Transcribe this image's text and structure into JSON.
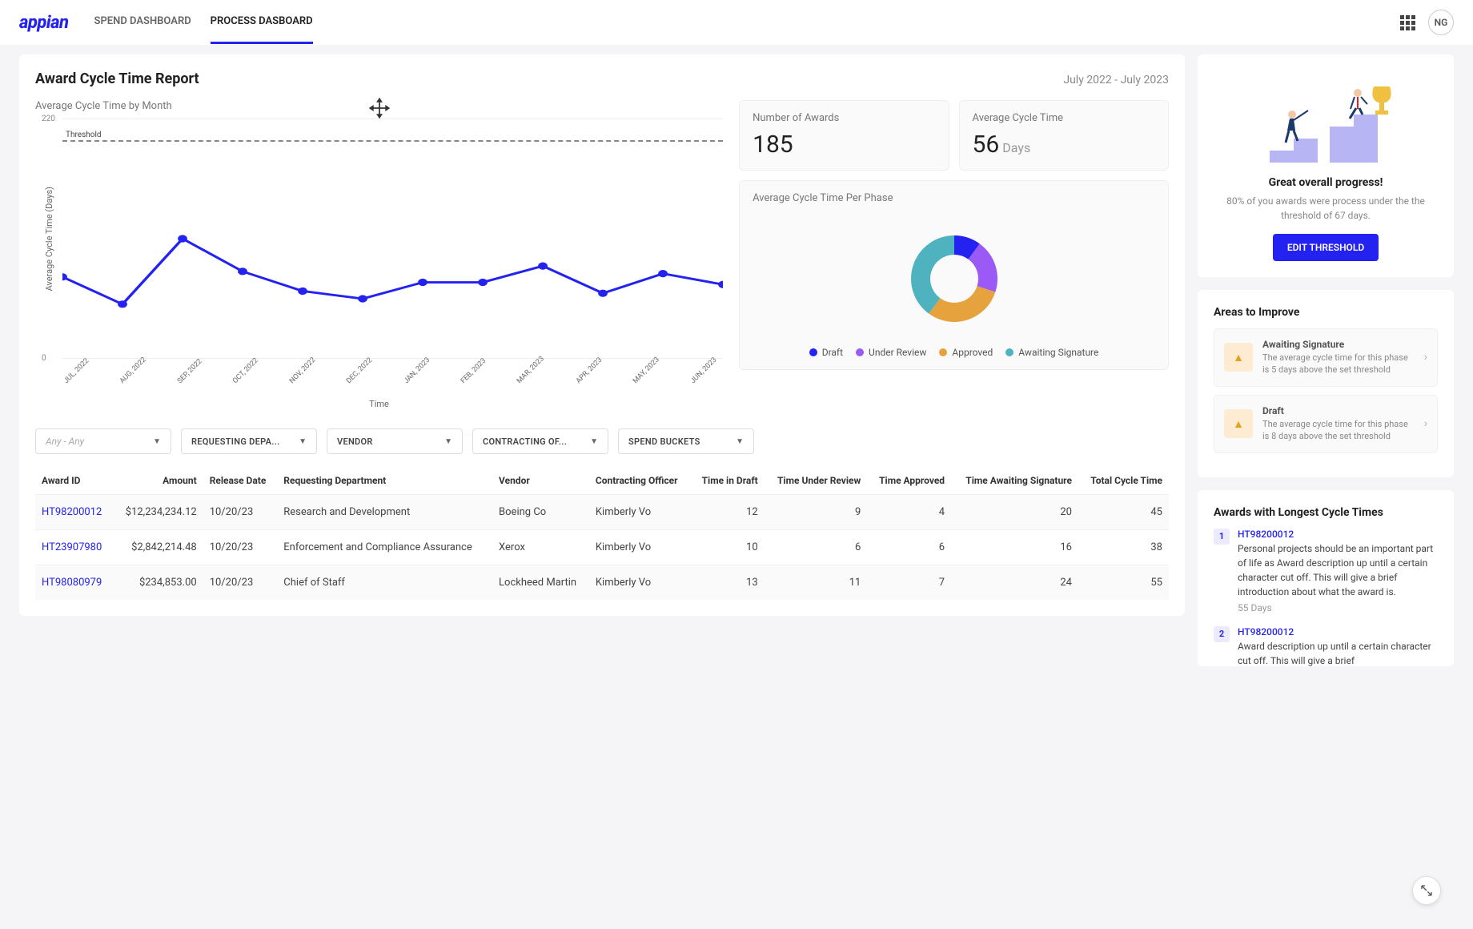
{
  "brand": "appian",
  "nav": {
    "tab1": "SPEND DASHBOARD",
    "tab2": "PROCESS DASBOARD"
  },
  "user_initials": "NG",
  "header": {
    "title": "Award Cycle Time Report",
    "date_range": "July 2022 - July 2023"
  },
  "kpi": {
    "awards_label": "Number of Awards",
    "awards_value": "185",
    "act_label": "Average Cycle Time",
    "act_value": "56",
    "act_unit": "Days"
  },
  "donut": {
    "title": "Average Cycle Time Per Phase",
    "legend": {
      "draft": "Draft",
      "review": "Under Review",
      "approved": "Approved",
      "awaiting": "Awaiting Signature"
    }
  },
  "line_chart": {
    "title": "Average Cycle Time by Month",
    "ylabel": "Average Cycle Time (Days)",
    "xlabel": "Time",
    "threshold_label": "Threshold",
    "tick0": "0",
    "tick220": "220"
  },
  "chart_data": {
    "line": {
      "type": "line",
      "title": "Average Cycle Time by Month",
      "xlabel": "Time",
      "ylabel": "Average Cycle Time (Days)",
      "ylim": [
        0,
        220
      ],
      "threshold": 200,
      "categories": [
        "JUL, 2022",
        "AUG, 2022",
        "SEP, 2022",
        "OCT, 2022",
        "NOV, 2022",
        "DEC, 2022",
        "JAN, 2023",
        "FEB, 2023",
        "MAR, 2023",
        "APR, 2023",
        "MAY, 2023",
        "JUN, 2023"
      ],
      "values": [
        75,
        50,
        110,
        80,
        62,
        55,
        70,
        70,
        85,
        60,
        78,
        68
      ]
    },
    "donut": {
      "type": "pie",
      "title": "Average Cycle Time Per Phase",
      "series": [
        {
          "name": "Draft",
          "value": 10,
          "color": "#2322f0"
        },
        {
          "name": "Under Review",
          "value": 20,
          "color": "#9b59f5"
        },
        {
          "name": "Approved",
          "value": 30,
          "color": "#e6a23c"
        },
        {
          "name": "Awaiting Signature",
          "value": 40,
          "color": "#4fb3bf"
        }
      ]
    }
  },
  "filters": {
    "range": "Any - Any",
    "dept": "REQUESTING DEPA...",
    "vendor": "VENDOR",
    "officer": "CONTRACTING OF...",
    "bucket": "SPEND BUCKETS"
  },
  "table": {
    "headers": {
      "award_id": "Award ID",
      "amount": "Amount",
      "release": "Release Date",
      "dept": "Requesting Department",
      "vendor": "Vendor",
      "officer": "Contracting Officer",
      "draft": "Time in Draft",
      "review": "Time Under Review",
      "approved": "Time Approved",
      "awaiting": "Time Awaiting Signature",
      "total": "Total Cycle Time"
    },
    "rows": [
      {
        "id": "HT98200012",
        "amount": "$12,234,234.12",
        "release": "10/20/23",
        "dept": "Research and Development",
        "vendor": "Boeing Co",
        "officer": "Kimberly Vo",
        "draft": "12",
        "review": "9",
        "approved": "4",
        "awaiting": "20",
        "total": "45"
      },
      {
        "id": "HT23907980",
        "amount": "$2,842,214.48",
        "release": "10/20/23",
        "dept": "Enforcement and Compliance Assurance",
        "vendor": "Xerox",
        "officer": "Kimberly Vo",
        "draft": "10",
        "review": "6",
        "approved": "6",
        "awaiting": "16",
        "total": "38"
      },
      {
        "id": "HT98080979",
        "amount": "$234,853.00",
        "release": "10/20/23",
        "dept": "Chief of Staff",
        "vendor": "Lockheed Martin",
        "officer": "Kimberly Vo",
        "draft": "13",
        "review": "11",
        "approved": "7",
        "awaiting": "24",
        "total": "55"
      }
    ]
  },
  "progress": {
    "title": "Great overall progress!",
    "sub": "80% of you awards were process under the the threshold of 67 days.",
    "button": "EDIT THRESHOLD"
  },
  "improve": {
    "title": "Areas to Improve",
    "items": [
      {
        "phase": "Awaiting Signature",
        "desc": "The average cycle time for this phase is 5 days above the set threshold"
      },
      {
        "phase": "Draft",
        "desc": "The average cycle time for this phase is 8 days above the set threshold"
      }
    ]
  },
  "longest": {
    "title": "Awards with Longest Cycle Times",
    "items": [
      {
        "rank": "1",
        "id": "HT98200012",
        "desc": "Personal projects should be an important part of life as Award description up until a certain character cut off. This will give a brief introduction about what the award is.",
        "days": "55 Days"
      },
      {
        "rank": "2",
        "id": "HT98200012",
        "desc": "Award description up until a certain character cut off. This will give a brief",
        "days": ""
      }
    ]
  }
}
